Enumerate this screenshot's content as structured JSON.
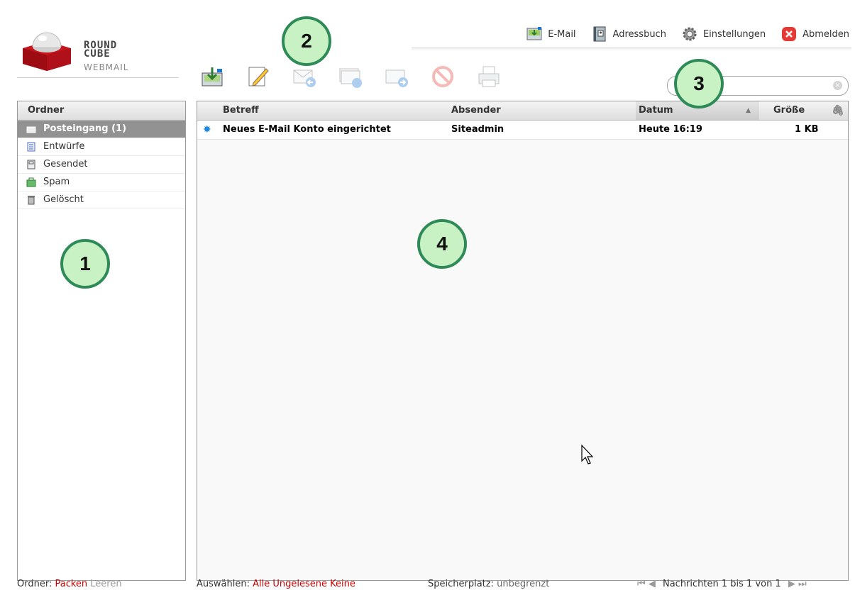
{
  "logo": {
    "line1": "ROUND",
    "line2": "CUBE",
    "line3": "WEBMAIL"
  },
  "topnav": [
    {
      "label": "E-Mail",
      "icon": "mail-icon"
    },
    {
      "label": "Adressbuch",
      "icon": "address-book-icon"
    },
    {
      "label": "Einstellungen",
      "icon": "gear-icon"
    },
    {
      "label": "Abmelden",
      "icon": "logout-icon"
    }
  ],
  "search": {
    "value": "",
    "placeholder": ""
  },
  "folders": {
    "header": "Ordner",
    "items": [
      {
        "label": "Posteingang (1)",
        "icon": "inbox-icon",
        "selected": true
      },
      {
        "label": "Entwürfe",
        "icon": "drafts-icon"
      },
      {
        "label": "Gesendet",
        "icon": "sent-icon"
      },
      {
        "label": "Spam",
        "icon": "spam-icon"
      },
      {
        "label": "Gelöscht",
        "icon": "trash-icon"
      }
    ]
  },
  "messages": {
    "columns": {
      "subject": "Betreff",
      "sender": "Absender",
      "date": "Datum",
      "size": "Größe"
    },
    "rows": [
      {
        "subject": "Neues E-Mail Konto eingerichtet",
        "sender": "Siteadmin",
        "date": "Heute 16:19",
        "size": "1 KB",
        "unread": true
      }
    ]
  },
  "footer": {
    "folders_label": "Ordner:",
    "compact": "Packen",
    "empty": "Leeren",
    "select_label": "Auswählen:",
    "select_all": "Alle",
    "select_unread": "Ungelesene",
    "select_none": "Keine",
    "quota_label": "Speicherplatz:",
    "quota_value": "unbegrenzt",
    "count": "Nachrichten 1 bis 1 von 1"
  },
  "callouts": [
    "1",
    "2",
    "3",
    "4"
  ],
  "colors": {
    "accent_red": "#cc0000",
    "selected_folder": "#929292",
    "callout_fill": "#c8f2c4",
    "callout_border": "#2e8b57"
  }
}
